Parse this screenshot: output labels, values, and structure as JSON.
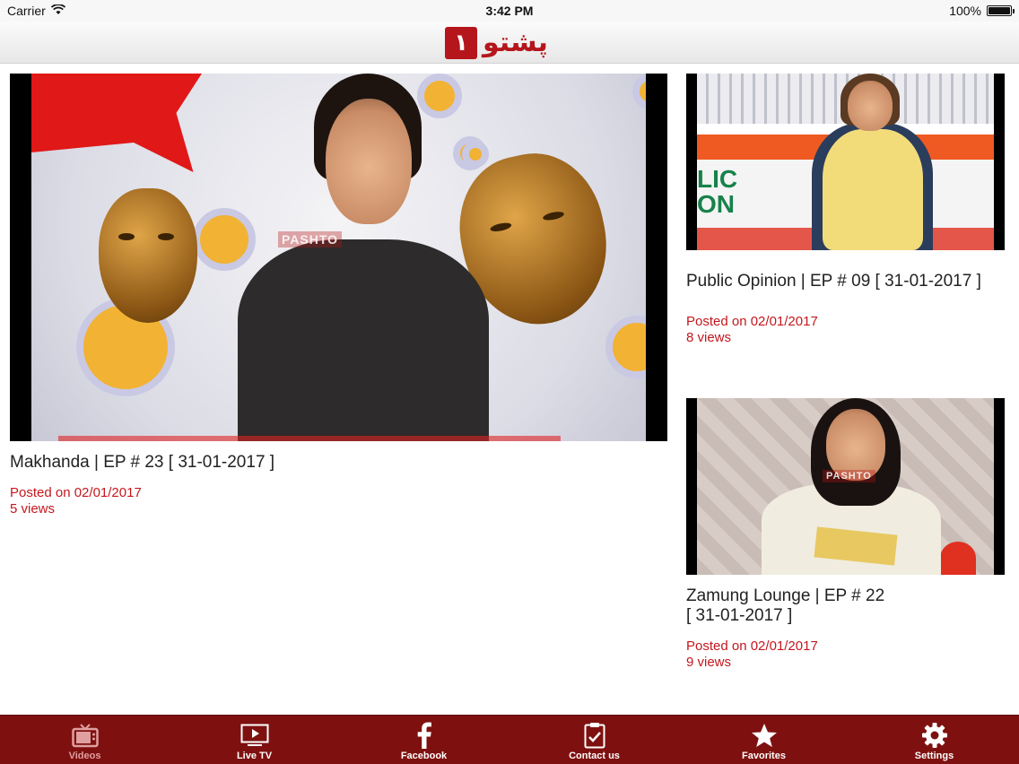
{
  "status_bar": {
    "carrier": "Carrier",
    "time": "3:42 PM",
    "battery": "100%",
    "battery_level": 1.0
  },
  "header": {
    "logo_number": "۱",
    "logo_text": "پشتو"
  },
  "videos": [
    {
      "title": "Makhanda | EP # 23 [ 31-01-2017 ]",
      "posted": "Posted on 02/01/2017",
      "views": "5 views",
      "channel_tag": "PASHTO"
    },
    {
      "title": "Public Opinion | EP # 09 [ 31-01-2017 ]",
      "posted": "Posted on 02/01/2017",
      "views": "8 views",
      "thumb_text": "LIC\nON"
    },
    {
      "title_line1": "Zamung Lounge | EP # 22",
      "title_line2": "[ 31-01-2017 ]",
      "posted": "Posted on 02/01/2017",
      "views": "9 views",
      "channel_tag": "PASHTO"
    }
  ],
  "tab_bar": {
    "tabs": [
      {
        "label": "Videos",
        "icon": "tv-icon",
        "active": true
      },
      {
        "label": "Live TV",
        "icon": "play-screen-icon",
        "active": false
      },
      {
        "label": "Facebook",
        "icon": "facebook-icon",
        "active": false
      },
      {
        "label": "Contact us",
        "icon": "clipboard-check-icon",
        "active": false
      },
      {
        "label": "Favorites",
        "icon": "star-icon",
        "active": false
      },
      {
        "label": "Settings",
        "icon": "gear-icon",
        "active": false
      }
    ]
  },
  "colors": {
    "accent": "#c4171d",
    "tab_bar": "#7e1110",
    "logo": "#b5161b"
  }
}
